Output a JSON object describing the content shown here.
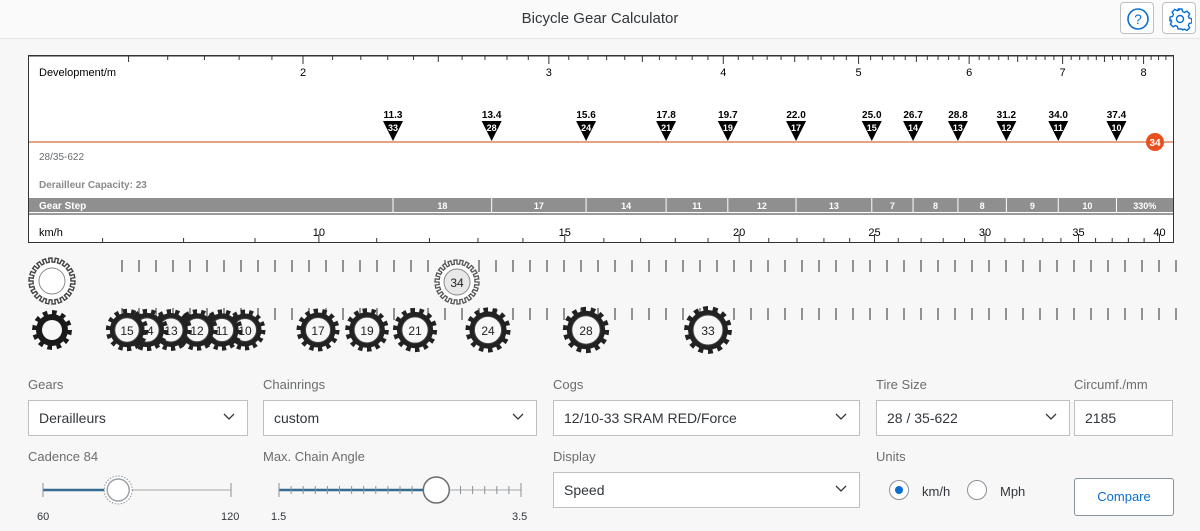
{
  "app": {
    "title": "Bicycle Gear Calculator"
  },
  "header": {
    "help_icon": "question-circle-icon",
    "settings_icon": "gear-icon"
  },
  "chart_data": {
    "type": "table",
    "dev_label": "Development/m",
    "dev_ticks": [
      2,
      3,
      4,
      5,
      6,
      7,
      8
    ],
    "gears": [
      {
        "dev": 2.32,
        "kmh": 11.3,
        "cog": 33
      },
      {
        "dev": 2.73,
        "kmh": 13.4,
        "cog": 28
      },
      {
        "dev": 3.19,
        "kmh": 15.6,
        "cog": 24
      },
      {
        "dev": 3.64,
        "kmh": 17.8,
        "cog": 21
      },
      {
        "dev": 4.03,
        "kmh": 19.7,
        "cog": 19
      },
      {
        "dev": 4.51,
        "kmh": 22.0,
        "cog": 17
      },
      {
        "dev": 5.11,
        "kmh": 25.0,
        "cog": 15
      },
      {
        "dev": 5.47,
        "kmh": 26.7,
        "cog": 14
      },
      {
        "dev": 5.89,
        "kmh": 28.8,
        "cog": 13
      },
      {
        "dev": 6.38,
        "kmh": 31.2,
        "cog": 12
      },
      {
        "dev": 6.95,
        "kmh": 34.0,
        "cog": 11
      },
      {
        "dev": 7.65,
        "kmh": 37.4,
        "cog": 10
      }
    ],
    "chainring": "34",
    "tire_text": "28/35-622",
    "capacity_text": "Derailleur Capacity: 23",
    "gear_step_label": "Gear Step",
    "gear_steps": [
      "18",
      "17",
      "14",
      "11",
      "12",
      "13",
      "7",
      "8",
      "8",
      "9",
      "10"
    ],
    "gear_range": "330%",
    "speed_label": "km/h",
    "speed_ticks": [
      10,
      15,
      20,
      25,
      30,
      35,
      40
    ],
    "colors": {
      "line": "#d56a3a",
      "badge": "#e8501f",
      "step_bar": "#8f8f8f",
      "marker": "#000000"
    }
  },
  "sprockets": {
    "chainrings": [
      "34"
    ],
    "cogs": [
      "10",
      "11",
      "12",
      "13",
      "14",
      "15",
      "17",
      "19",
      "21",
      "24",
      "28",
      "33"
    ]
  },
  "controls": {
    "gears": {
      "label": "Gears",
      "value": "Derailleurs"
    },
    "chainrings": {
      "label": "Chainrings",
      "value": "custom"
    },
    "cogs": {
      "label": "Cogs",
      "value": "12/10-33 SRAM RED/Force"
    },
    "tire_size": {
      "label": "Tire Size",
      "value": "28 / 35-622"
    },
    "circumf": {
      "label": "Circumf./mm",
      "value": "2185"
    },
    "cadence": {
      "label": "Cadence 84",
      "min": "60",
      "max": "120",
      "value": 84,
      "range": [
        60,
        120
      ]
    },
    "chain_angle": {
      "label": "Max. Chain Angle",
      "min": "1.5",
      "max": "3.5",
      "value": 2.8,
      "range": [
        1.5,
        3.5
      ]
    },
    "display": {
      "label": "Display",
      "value": "Speed"
    },
    "units": {
      "label": "Units",
      "option1": "km/h",
      "option2": "Mph",
      "selected": "km/h"
    },
    "compare": {
      "label": "Compare"
    }
  }
}
